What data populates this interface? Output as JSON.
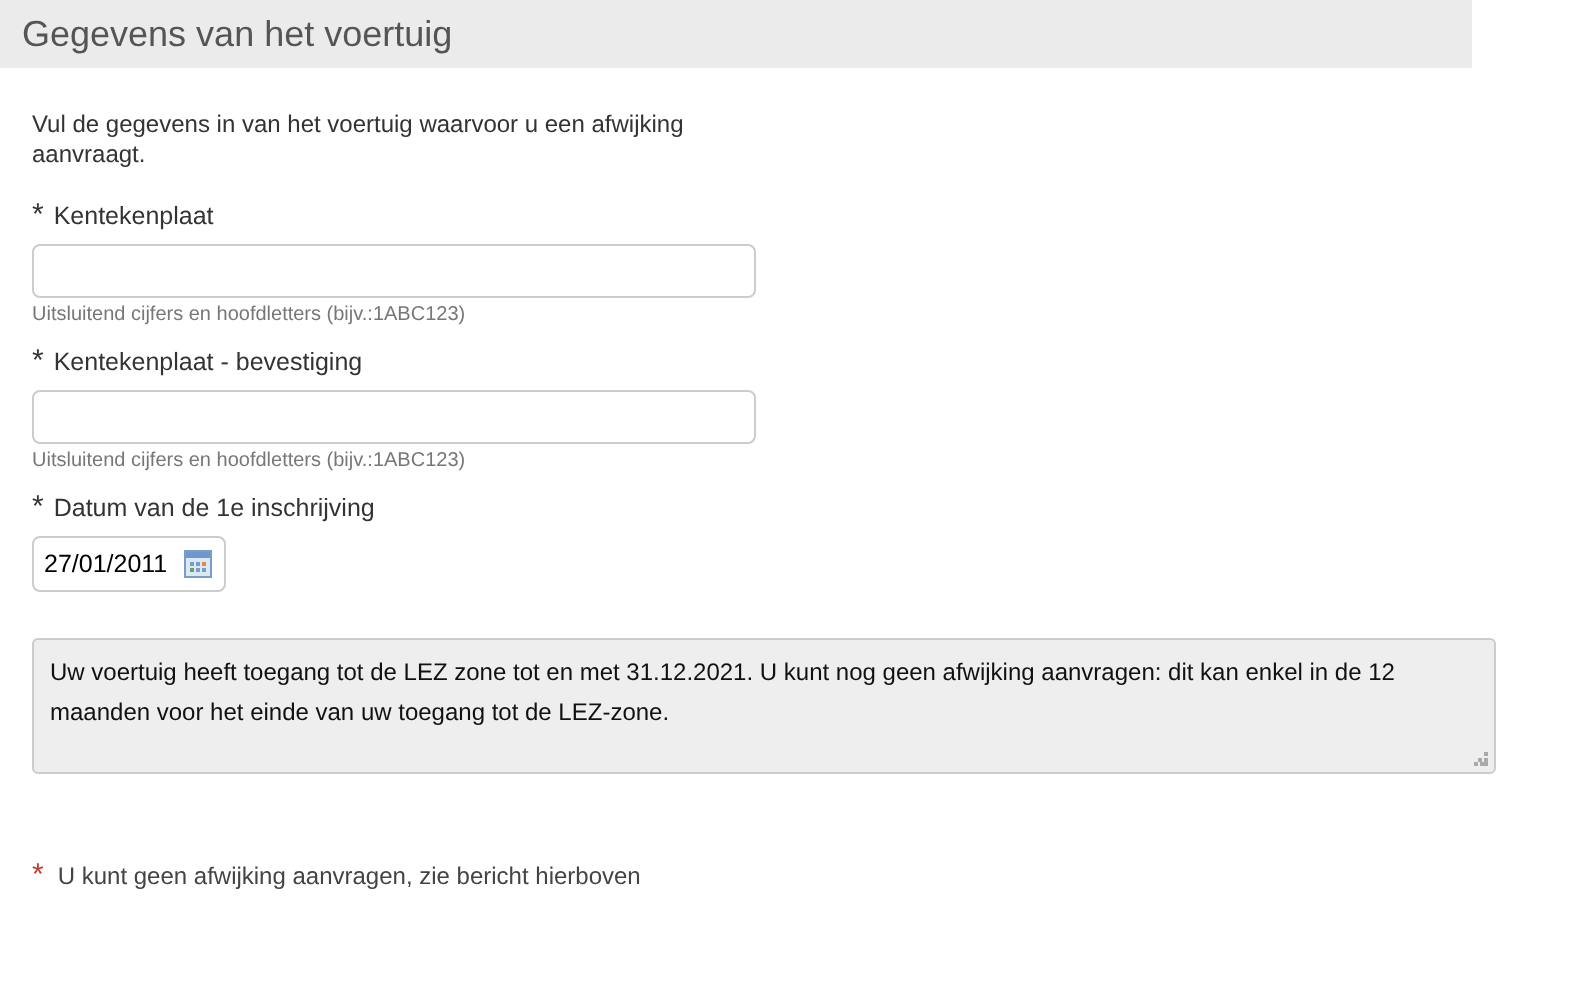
{
  "section": {
    "title": "Gegevens van het voertuig"
  },
  "intro": "Vul de gegevens in van het voertuig waarvoor u een afwijking aanvraagt.",
  "fields": [
    {
      "kind": "text",
      "marker": "*",
      "label": "Kentekenplaat",
      "hint": "Uitsluitend cijfers en hoofdletters (bijv.:1ABC123)"
    },
    {
      "kind": "text",
      "marker": "*",
      "label": "Kentekenplaat - bevestiging",
      "hint": "Uitsluitend cijfers en hoofdletters (bijv.:1ABC123)"
    },
    {
      "kind": "date",
      "marker": "*",
      "label": "Datum van de 1e inschrijving",
      "value": "27/01/2011"
    }
  ],
  "message": "Uw voertuig heeft toegang tot de LEZ zone tot en met 31.12.2021. U kunt nog geen afwijking aanvragen: dit kan enkel in de 12 maanden voor het einde van uw toegang tot de LEZ-zone.",
  "error": {
    "marker": "*",
    "text": "U kunt geen afwijking aanvragen, zie bericht hierboven"
  }
}
